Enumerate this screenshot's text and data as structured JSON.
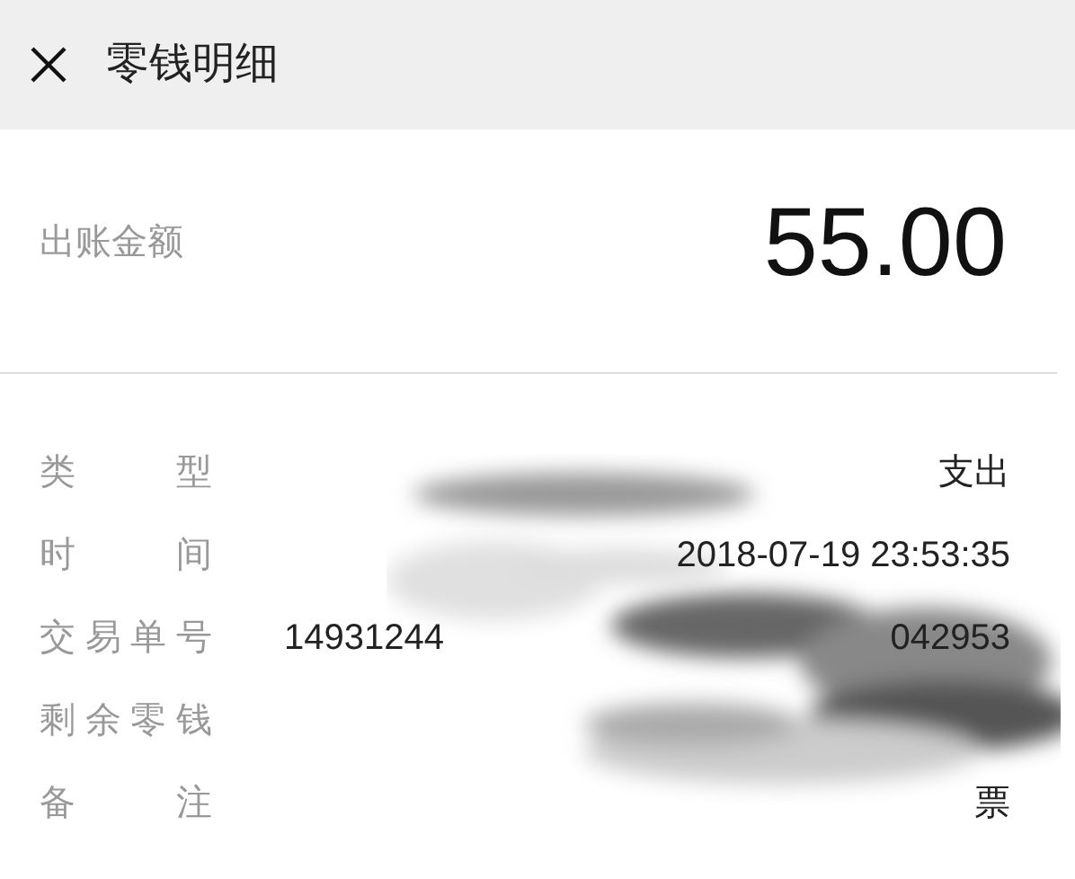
{
  "header": {
    "title": "零钱明细"
  },
  "amount": {
    "label": "出账金额",
    "value": "55.00"
  },
  "details": [
    {
      "label": "类型",
      "values": [
        "支出"
      ]
    },
    {
      "label": "时间",
      "values": [
        "2018-07-19 23:53:35"
      ]
    },
    {
      "label": "交易单号",
      "values": [
        "14931244",
        "042953"
      ]
    },
    {
      "label": "剩余零钱"
    },
    {
      "label": "备注",
      "values": [
        "票"
      ]
    }
  ]
}
